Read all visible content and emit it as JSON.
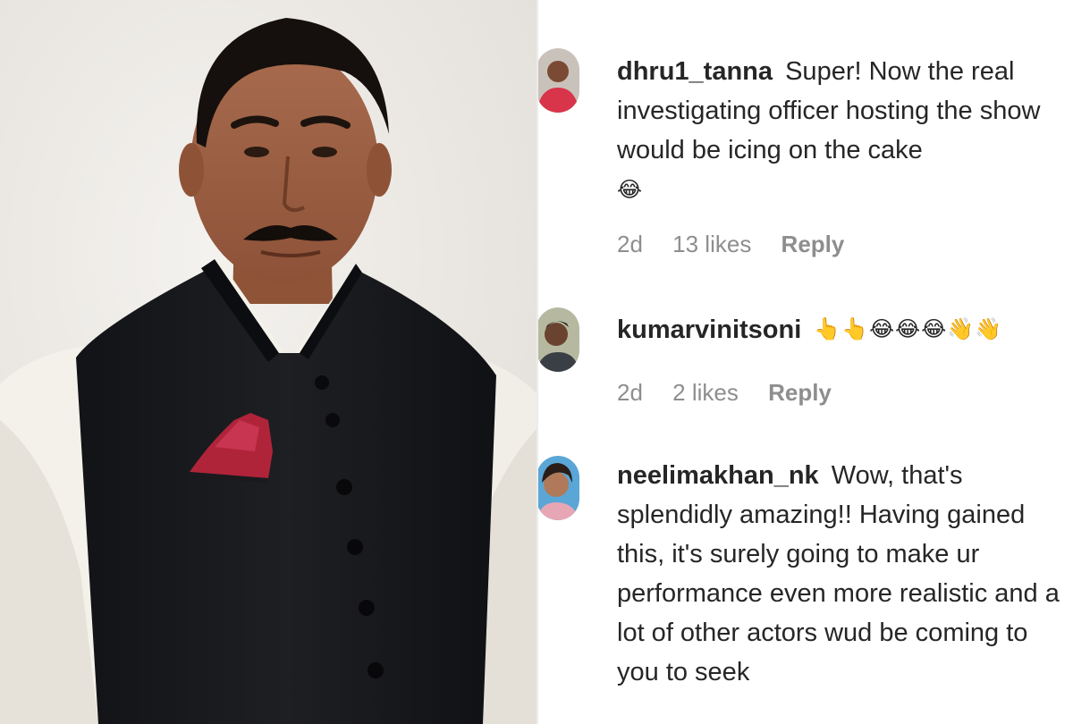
{
  "comments": [
    {
      "username": "dhru1_tanna",
      "text": "Super! Now the real investigating officer hosting the show would be icing on the cake",
      "emoji": "😂",
      "time": "2d",
      "likes": "13 likes",
      "reply_label": "Reply"
    },
    {
      "username": "kumarvinitsoni",
      "text": "",
      "emoji": "👆👆😂😂😂👋👋",
      "time": "2d",
      "likes": "2 likes",
      "reply_label": "Reply"
    },
    {
      "username": "neelimakhan_nk",
      "text": "Wow, that's splendidly amazing!! Having gained this, it's surely going to make ur performance even more realistic and a lot of other actors wud be coming to you to seek",
      "emoji": "",
      "time": "",
      "likes": "",
      "reply_label": ""
    }
  ],
  "colors": {
    "username": "#262626",
    "meta": "#8e8e8e",
    "vest": "#17181b",
    "shirt": "#f4f1ea",
    "pocket_square": "#b0243a",
    "background": "#ece9e4"
  }
}
